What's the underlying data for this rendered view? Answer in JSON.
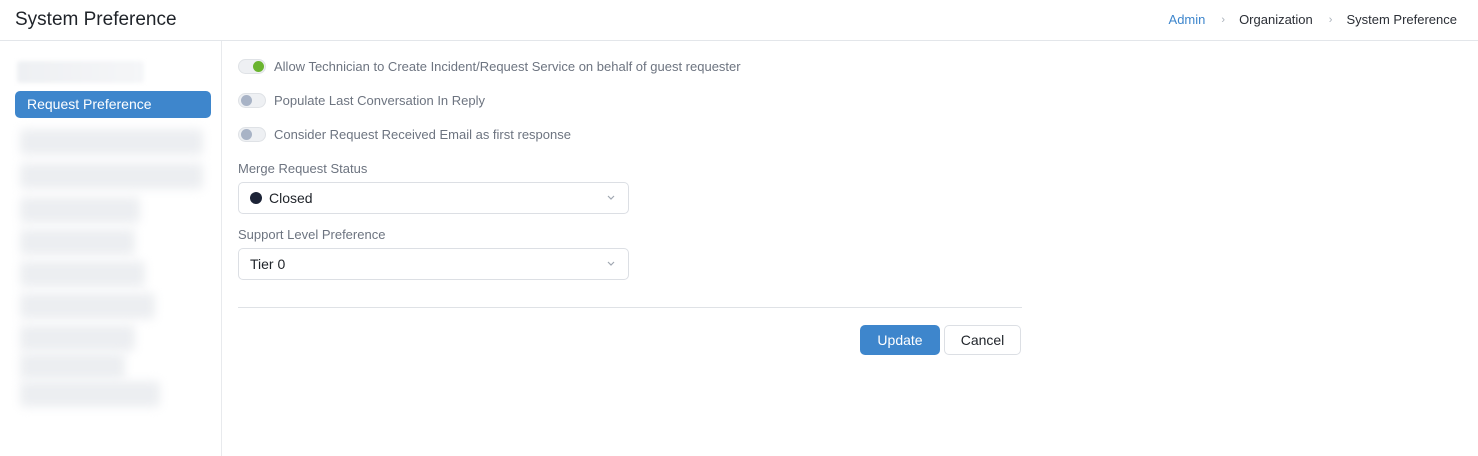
{
  "header": {
    "title": "System Preference",
    "breadcrumb": [
      "Admin",
      "Organization",
      "System Preference"
    ],
    "separator": "›"
  },
  "sidebar": {
    "active_item": "Request Preference"
  },
  "toggles": [
    {
      "label": "Allow Technician to Create Incident/Request Service on behalf of guest requester",
      "on": true
    },
    {
      "label": "Populate Last Conversation In Reply",
      "on": false
    },
    {
      "label": "Consider Request Received Email as first response",
      "on": false
    }
  ],
  "merge_status": {
    "label": "Merge Request Status",
    "value": "Closed",
    "status_color": "#1c2336"
  },
  "support_level": {
    "label": "Support Level Preference",
    "value": "Tier 0"
  },
  "actions": {
    "update_label": "Update",
    "cancel_label": "Cancel"
  },
  "colors": {
    "accent": "#3e86cc",
    "toggle_on": "#6ab42f",
    "toggle_off": "#a8b3c6"
  }
}
